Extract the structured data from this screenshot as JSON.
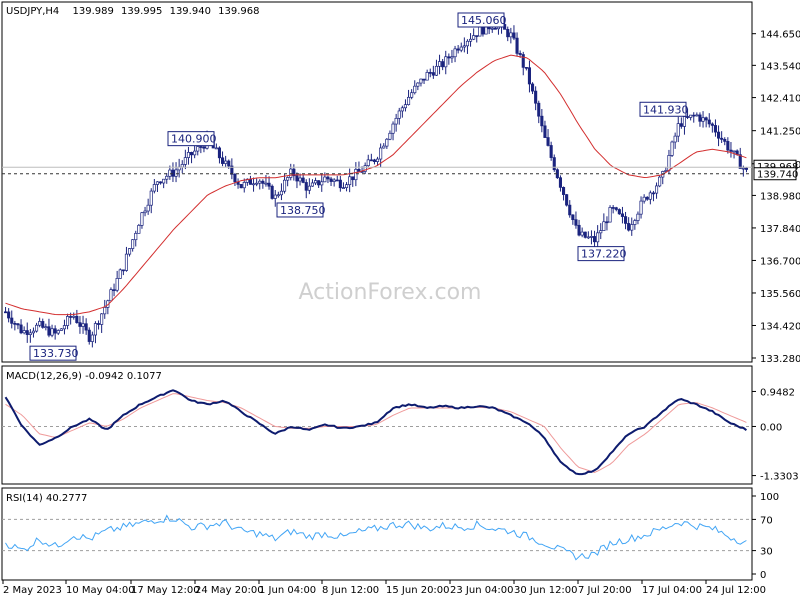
{
  "header": {
    "symbol": "USDJPY,H4",
    "open": "139.989",
    "high": "139.995",
    "low": "139.940",
    "close": "139.968"
  },
  "watermark": "ActionForex.com",
  "colors": {
    "candle": "#1a237e",
    "sma": "#d32f2f",
    "macd_main": "#0d1b6e",
    "macd_signal": "#ef9a9a",
    "rsi": "#42a5f5",
    "grid_dashed": "#9e9e9e"
  },
  "chart_data": [
    {
      "type": "candlestick",
      "panel": "price",
      "title": "USDJPY,H4  139.989 139.995 139.940 139.968",
      "y_ticks": [
        "144.650",
        "143.540",
        "142.410",
        "141.250",
        "140.090",
        "138.980",
        "137.840",
        "136.700",
        "135.560",
        "134.420",
        "133.280"
      ],
      "ylim": [
        133.28,
        145.2
      ],
      "current_price_labels": [
        "139.968",
        "139.740"
      ],
      "annotations": [
        {
          "text": "133.730",
          "value": 133.73
        },
        {
          "text": "140.900",
          "value": 140.9
        },
        {
          "text": "138.750",
          "value": 138.75
        },
        {
          "text": "145.060",
          "value": 145.06
        },
        {
          "text": "137.220",
          "value": 137.22
        },
        {
          "text": "141.930",
          "value": 141.93
        }
      ],
      "key_closes": [
        134.9,
        134.2,
        134.4,
        134.1,
        134.8,
        134.0,
        135.2,
        136.5,
        138.2,
        139.5,
        139.8,
        140.4,
        140.9,
        140.1,
        139.3,
        139.6,
        138.9,
        139.8,
        139.2,
        139.6,
        139.4,
        139.8,
        140.3,
        141.5,
        142.5,
        143.2,
        143.6,
        144.3,
        144.7,
        145.0,
        144.6,
        143.2,
        141.0,
        139.3,
        137.6,
        137.4,
        138.5,
        137.9,
        138.9,
        139.6,
        141.5,
        141.8,
        141.4,
        140.6,
        139.8
      ],
      "series": [
        {
          "name": "SMA",
          "values": [
            135.2,
            135.0,
            134.9,
            134.8,
            134.8,
            134.9,
            135.1,
            135.7,
            136.4,
            137.1,
            137.8,
            138.4,
            139.0,
            139.3,
            139.5,
            139.6,
            139.6,
            139.7,
            139.7,
            139.7,
            139.7,
            139.8,
            140.0,
            140.4,
            141.0,
            141.6,
            142.2,
            142.8,
            143.3,
            143.7,
            143.9,
            143.8,
            143.3,
            142.5,
            141.5,
            140.6,
            140.0,
            139.7,
            139.6,
            139.7,
            140.1,
            140.5,
            140.6,
            140.5,
            140.3
          ]
        }
      ]
    },
    {
      "type": "line",
      "panel": "macd",
      "title": "MACD(12,26,9) -0.0942 0.1077",
      "y_ticks": [
        "0.9482",
        "0.00",
        "-1.3303"
      ],
      "ylim": [
        -1.45,
        1.15
      ],
      "series": [
        {
          "name": "MACD",
          "values": [
            0.8,
            0.0,
            -0.5,
            -0.3,
            0.0,
            0.2,
            -0.1,
            0.3,
            0.6,
            0.8,
            1.0,
            0.7,
            0.6,
            0.7,
            0.4,
            0.1,
            -0.2,
            0.0,
            -0.1,
            0.05,
            -0.05,
            0.0,
            0.1,
            0.5,
            0.6,
            0.5,
            0.55,
            0.5,
            0.55,
            0.5,
            0.3,
            0.1,
            -0.3,
            -1.0,
            -1.3,
            -1.2,
            -0.7,
            -0.2,
            0.0,
            0.4,
            0.75,
            0.6,
            0.4,
            0.1,
            -0.09
          ]
        },
        {
          "name": "Signal",
          "values": [
            0.6,
            0.3,
            -0.2,
            -0.3,
            -0.1,
            0.1,
            0.0,
            0.2,
            0.5,
            0.7,
            0.9,
            0.8,
            0.7,
            0.65,
            0.5,
            0.25,
            0.0,
            -0.05,
            -0.05,
            0.0,
            0.0,
            0.0,
            0.05,
            0.3,
            0.5,
            0.5,
            0.5,
            0.5,
            0.52,
            0.5,
            0.4,
            0.2,
            0.0,
            -0.6,
            -1.1,
            -1.25,
            -1.0,
            -0.5,
            -0.2,
            0.2,
            0.6,
            0.65,
            0.5,
            0.3,
            0.11
          ]
        }
      ]
    },
    {
      "type": "line",
      "panel": "rsi",
      "title": "RSI(14) 40.2777",
      "y_ticks": [
        "100",
        "70",
        "30",
        "0"
      ],
      "ylim": [
        0,
        100
      ],
      "series": [
        {
          "name": "RSI",
          "values": [
            40,
            30,
            45,
            35,
            50,
            45,
            55,
            60,
            65,
            70,
            72,
            60,
            62,
            66,
            55,
            52,
            45,
            55,
            48,
            52,
            47,
            54,
            58,
            63,
            64,
            58,
            62,
            60,
            63,
            58,
            55,
            48,
            40,
            30,
            22,
            26,
            40,
            45,
            50,
            58,
            67,
            62,
            58,
            48,
            40
          ]
        }
      ]
    }
  ],
  "x_axis": {
    "tick_labels": [
      "2 May 2023",
      "10 May 04:00",
      "17 May 12:00",
      "24 May 20:00",
      "1 Jun 04:00",
      "8 Jun 12:00",
      "15 Jun 20:00",
      "23 Jun 04:00",
      "30 Jun 12:00",
      "7 Jul 20:00",
      "17 Jul 04:00",
      "24 Jul 12:00"
    ]
  }
}
